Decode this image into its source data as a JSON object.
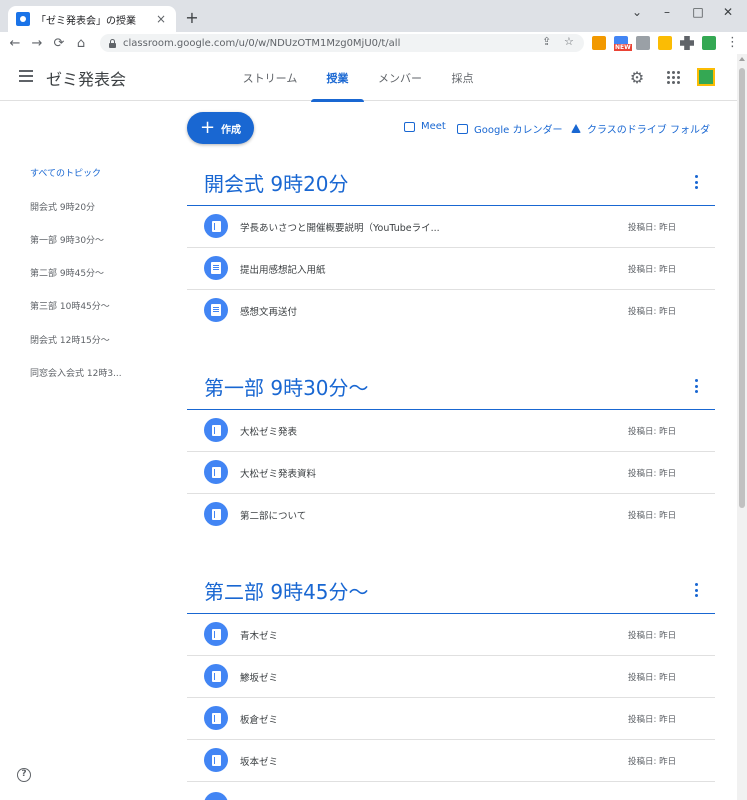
{
  "browser": {
    "tab_title": "「ゼミ発表会」の授業",
    "tab_close": "×",
    "new_tab": "+",
    "url": "classroom.google.com/u/0/w/NDUzOTM1Mzg0MjU0/t/all",
    "window_controls": {
      "minimize": "–",
      "maximize": "□",
      "close": "✕",
      "chevron": "⌄"
    },
    "nav": {
      "back": "←",
      "forward": "→",
      "reload": "⟳",
      "home": "⌂"
    },
    "omnibox_icons": {
      "share": "⇪",
      "star": "☆"
    },
    "extension_badge": "NEW",
    "menu": "⋮"
  },
  "header": {
    "class_name": "ゼミ発表会",
    "tabs": [
      {
        "label": "ストリーム",
        "active": false
      },
      {
        "label": "授業",
        "active": true
      },
      {
        "label": "メンバー",
        "active": false
      },
      {
        "label": "採点",
        "active": false
      }
    ],
    "settings_icon": "⚙"
  },
  "sidebar": {
    "topics": [
      {
        "label": "すべてのトピック",
        "active": true
      },
      {
        "label": "開会式 9時20分",
        "active": false
      },
      {
        "label": "第一部 9時30分～",
        "active": false
      },
      {
        "label": "第二部 9時45分～",
        "active": false
      },
      {
        "label": "第三部 10時45分～",
        "active": false
      },
      {
        "label": "閉会式 12時15分～",
        "active": false
      },
      {
        "label": "同窓会入会式 12時3...",
        "active": false
      }
    ],
    "help": "?"
  },
  "main": {
    "create_label": "作成",
    "create_plus": "+",
    "links": {
      "meet": "Meet",
      "calendar": "Google カレンダー",
      "drive": "クラスのドライブ フォルダ"
    },
    "topics": [
      {
        "title": "開会式 9時20分",
        "items": [
          {
            "title": "学長あいさつと開催概要説明（YouTubeライ...",
            "meta": "投稿日: 昨日",
            "icon": "material"
          },
          {
            "title": "提出用感想記入用紙",
            "meta": "投稿日: 昨日",
            "icon": "assignment"
          },
          {
            "title": "感想文再送付",
            "meta": "投稿日: 昨日",
            "icon": "assignment"
          }
        ]
      },
      {
        "title": "第一部 9時30分～",
        "items": [
          {
            "title": "大松ゼミ発表",
            "meta": "投稿日: 昨日",
            "icon": "material"
          },
          {
            "title": "大松ゼミ発表資料",
            "meta": "投稿日: 昨日",
            "icon": "material"
          },
          {
            "title": "第二部について",
            "meta": "投稿日: 昨日",
            "icon": "material"
          }
        ]
      },
      {
        "title": "第二部 9時45分～",
        "items": [
          {
            "title": "青木ゼミ",
            "meta": "投稿日: 昨日",
            "icon": "material"
          },
          {
            "title": "鯵坂ゼミ",
            "meta": "投稿日: 昨日",
            "icon": "material"
          },
          {
            "title": "板倉ゼミ",
            "meta": "投稿日: 昨日",
            "icon": "material"
          },
          {
            "title": "坂本ゼミ",
            "meta": "投稿日: 昨日",
            "icon": "material"
          }
        ]
      }
    ]
  }
}
